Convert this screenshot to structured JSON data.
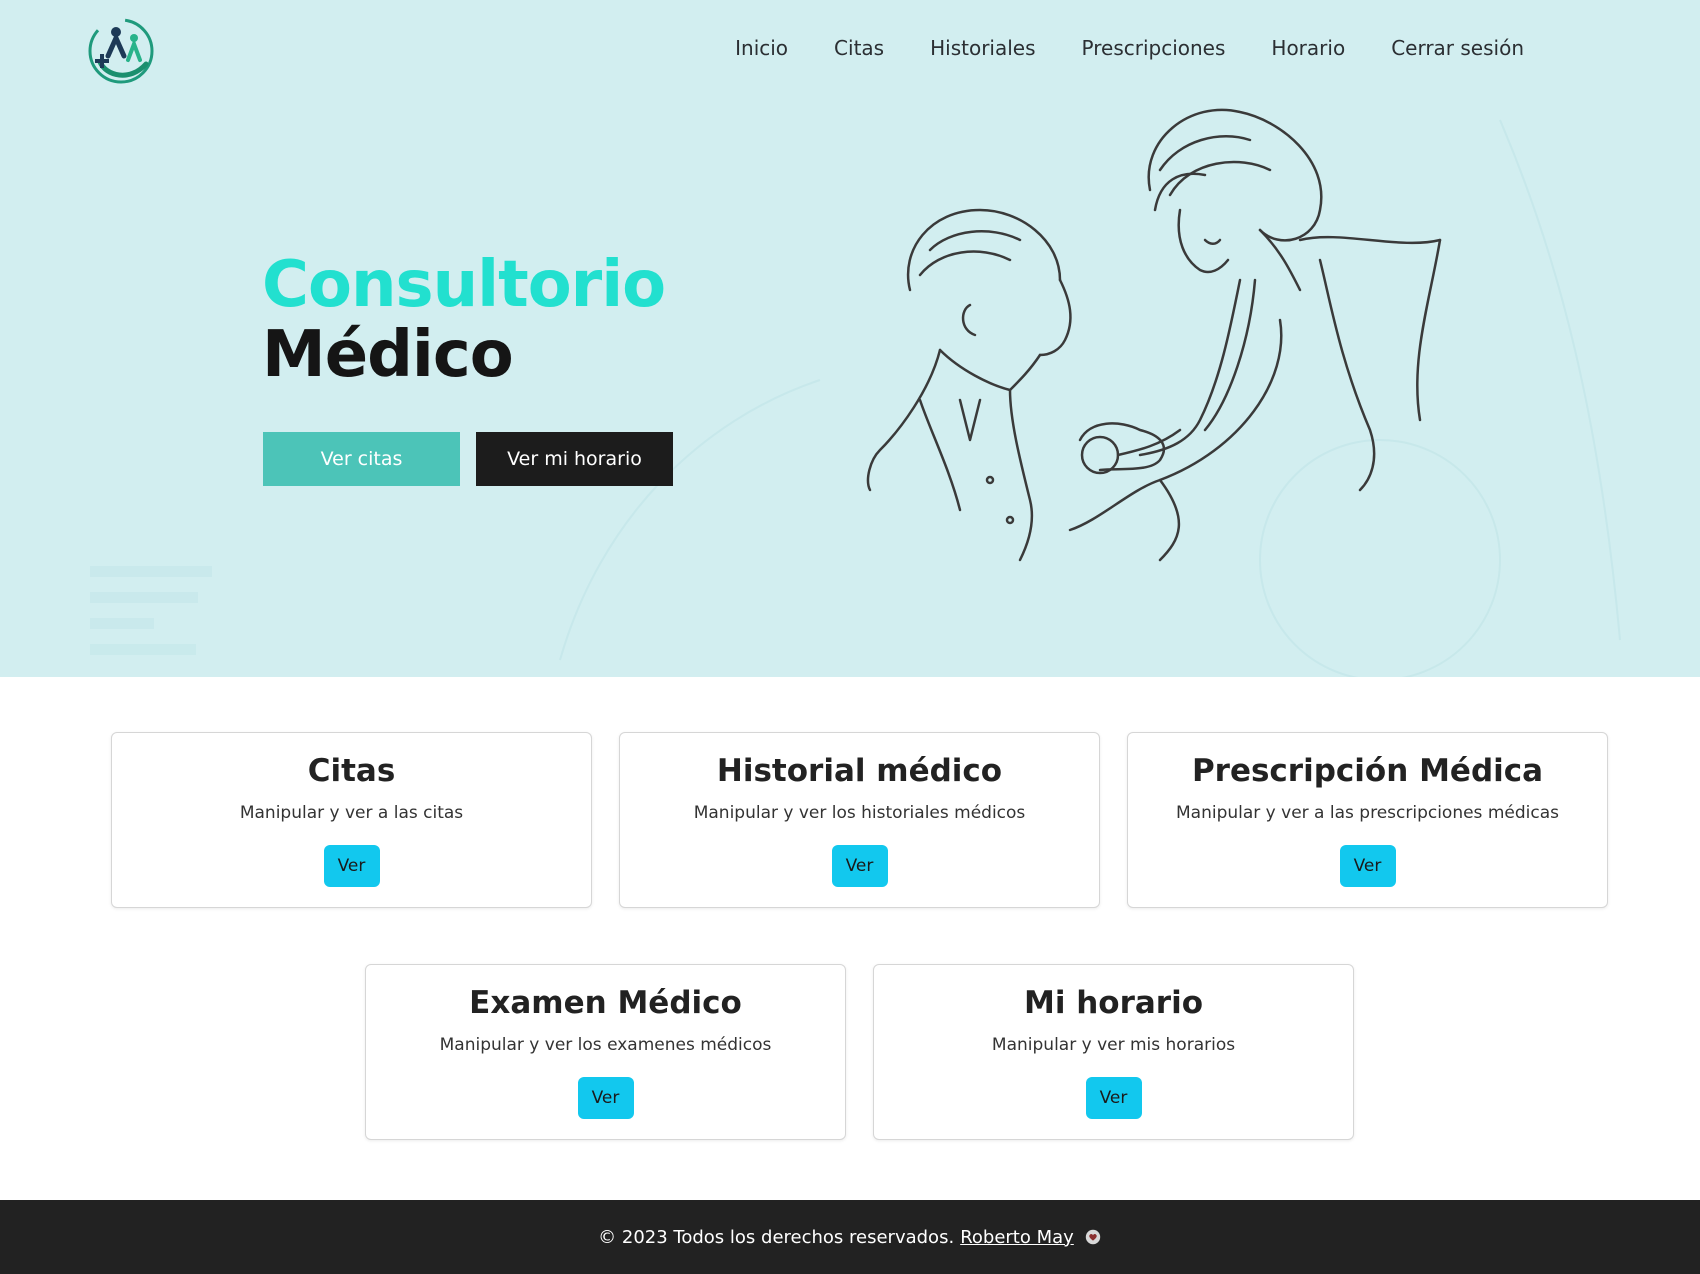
{
  "nav": {
    "items": [
      {
        "label": "Inicio"
      },
      {
        "label": "Citas"
      },
      {
        "label": "Historiales"
      },
      {
        "label": "Prescripciones"
      },
      {
        "label": "Horario"
      },
      {
        "label": "Cerrar sesión"
      }
    ]
  },
  "hero": {
    "title_line1": "Consultorio",
    "title_line2": "Médico",
    "btn_citas": "Ver citas",
    "btn_horario": "Ver mi horario"
  },
  "cards": [
    {
      "title": "Citas",
      "text": "Manipular y ver a las citas",
      "button": "Ver"
    },
    {
      "title": "Historial médico",
      "text": "Manipular y ver los historiales médicos",
      "button": "Ver"
    },
    {
      "title": "Prescripción Médica",
      "text": "Manipular y ver a las prescripciones médicas",
      "button": "Ver"
    },
    {
      "title": "Examen Médico",
      "text": "Manipular y ver los examenes médicos",
      "button": "Ver"
    },
    {
      "title": "Mi horario",
      "text": "Manipular y ver mis horarios",
      "button": "Ver"
    }
  ],
  "footer": {
    "text": "© 2023 Todos los derechos reservados.",
    "author": "Roberto May"
  },
  "colors": {
    "hero_bg": "#d2eef0",
    "accent": "#22e0cf",
    "btn_teal": "#4cc4b8",
    "btn_dark": "#1c1c1c",
    "card_btn": "#12c8ee",
    "footer_bg": "#222222"
  },
  "icons": {
    "logo": "medical-logo-icon",
    "footer": "heart-icon"
  }
}
